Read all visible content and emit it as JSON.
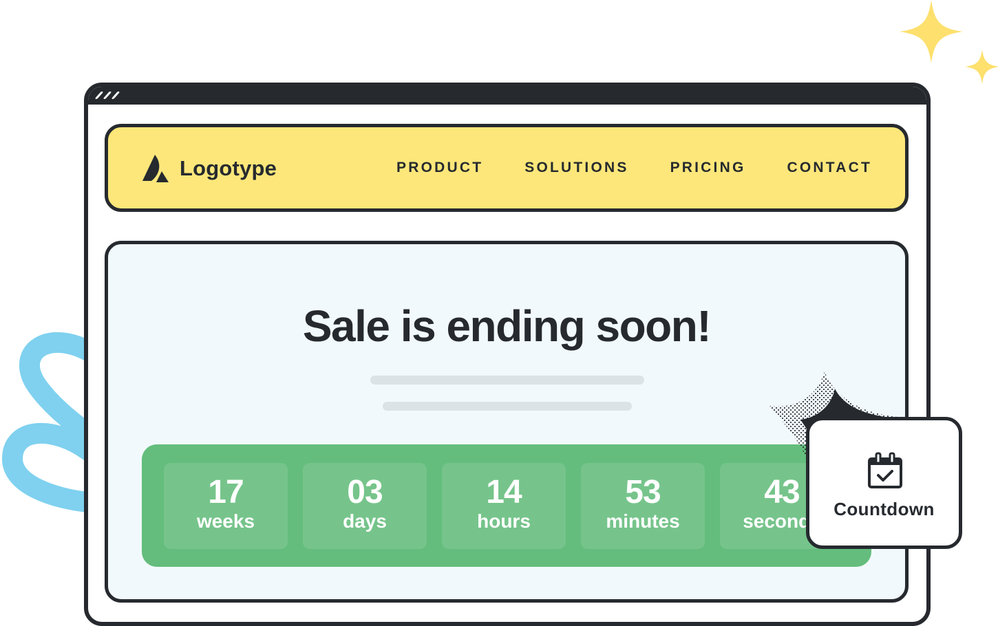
{
  "window": {
    "titlebar_icon": "window-dots-icon"
  },
  "nav": {
    "logo_icon": "logotype-mark-icon",
    "logo_text": "Logotype",
    "links": [
      {
        "label": "PRODUCT"
      },
      {
        "label": "SOLUTIONS"
      },
      {
        "label": "PRICING"
      },
      {
        "label": "CONTACT"
      }
    ]
  },
  "hero": {
    "title": "Sale is ending soon!",
    "countdown": [
      {
        "value": "17",
        "unit": "weeks"
      },
      {
        "value": "03",
        "unit": "days"
      },
      {
        "value": "14",
        "unit": "hours"
      },
      {
        "value": "53",
        "unit": "minutes"
      },
      {
        "value": "43",
        "unit": "seconds"
      }
    ]
  },
  "card": {
    "icon": "calendar-check-icon",
    "label": "Countdown"
  },
  "colors": {
    "outline": "#262a2f",
    "nav_bg": "#fde77a",
    "hero_bg": "#f1f9fc",
    "countdown_bg": "#64bd7c",
    "countdown_box": "#76c48b",
    "sparkle": "#fde06d",
    "squiggle": "#7fd1ef"
  }
}
